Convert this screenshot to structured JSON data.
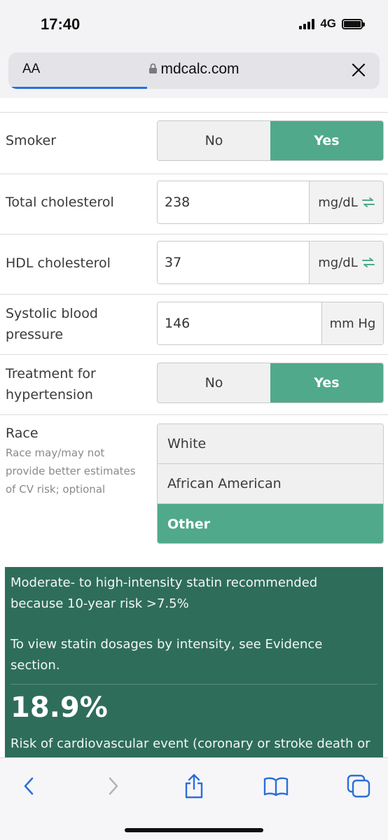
{
  "status_bar": {
    "time": "17:40",
    "network": "4G",
    "icons": [
      "signal-icon",
      "battery-icon"
    ]
  },
  "browser": {
    "text_size_label": "AA",
    "url": "mdcalc.com",
    "icons": [
      "lock-icon",
      "close-icon"
    ]
  },
  "form": {
    "smoker": {
      "label": "Smoker",
      "options": [
        "No",
        "Yes"
      ],
      "selected": "Yes"
    },
    "total_cholesterol": {
      "label": "Total cholesterol",
      "value": "238",
      "unit": "mg/dL"
    },
    "hdl_cholesterol": {
      "label": "HDL cholesterol",
      "value": "37",
      "unit": "mg/dL"
    },
    "systolic_bp": {
      "label_line1": "Systolic blood",
      "label_line2": "pressure",
      "value": "146",
      "unit": "mm Hg"
    },
    "hypertension_treatment": {
      "label_line1": "Treatment for",
      "label_line2": "hypertension",
      "options": [
        "No",
        "Yes"
      ],
      "selected": "Yes"
    },
    "race": {
      "label": "Race",
      "note_line1": "Race may/may not",
      "note_line2": "provide better estimates",
      "note_line3": "of CV risk; optional",
      "options": [
        "White",
        "African American",
        "Other"
      ],
      "selected": "Other"
    }
  },
  "result": {
    "recommendation_line1": "Moderate- to high-intensity statin recommended",
    "recommendation_line2": "because 10-year risk >7.5%",
    "evidence_line1": "To view statin dosages by intensity, see Evidence",
    "evidence_line2": "section.",
    "value": "18.9%",
    "description": "Risk of cardiovascular event (coronary or stroke death or"
  },
  "toolbar": {
    "icons": [
      "back-icon",
      "forward-icon",
      "share-icon",
      "bookmarks-icon",
      "tabs-icon"
    ]
  },
  "colors": {
    "accent_green": "#50a98b",
    "result_bg": "#2f6d5b",
    "safari_blue": "#2a6fdb"
  }
}
